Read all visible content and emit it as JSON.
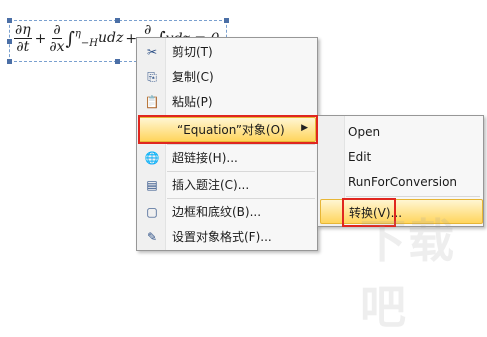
{
  "equation": {
    "frac1_num": "∂η",
    "frac1_den": "∂t",
    "plus": "+",
    "frac2_num": "∂",
    "frac2_den": "∂x",
    "integral": "∫",
    "lower": "−H",
    "upper": "η",
    "integrand": "udz",
    "plus2": "+",
    "frac3_num": "∂",
    "frac3_den": "∂y",
    "tail": "∫",
    "tail_text": "vdz = 0"
  },
  "menu": {
    "items": [
      {
        "label": "剪切(T)",
        "icon": "scissors-icon",
        "glyph": "✂"
      },
      {
        "label": "复制(C)",
        "icon": "copy-icon",
        "glyph": "⎘"
      },
      {
        "label": "粘贴(P)",
        "icon": "paste-icon",
        "glyph": "📋"
      },
      {
        "label": "“Equation”对象(O)",
        "icon": "none",
        "glyph": "",
        "arrow": "▶"
      },
      {
        "label": "超链接(H)...",
        "icon": "hyperlink-icon",
        "glyph": "🌐"
      },
      {
        "label": "插入题注(C)...",
        "icon": "caption-icon",
        "glyph": "▤"
      },
      {
        "label": "边框和底纹(B)...",
        "icon": "borders-icon",
        "glyph": "▢"
      },
      {
        "label": "设置对象格式(F)...",
        "icon": "format-object-icon",
        "glyph": "✎"
      }
    ]
  },
  "submenu": {
    "items": [
      {
        "label": "Open"
      },
      {
        "label": "Edit"
      },
      {
        "label": "RunForConversion"
      },
      {
        "label": "转换(V)..."
      }
    ]
  },
  "watermark": "下载吧",
  "colors": {
    "highlight_top": "#fff6d3",
    "highlight_bottom": "#ffd55d",
    "annotation_red": "#e0261f"
  }
}
